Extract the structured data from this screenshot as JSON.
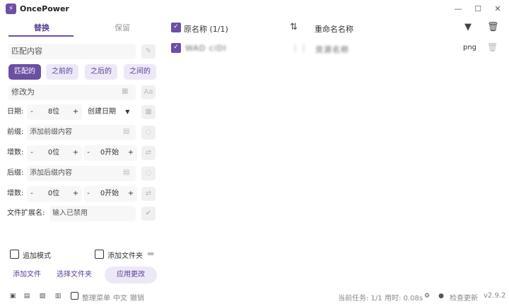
{
  "app": {
    "title": "OncePower",
    "logo_glyph": "⚡"
  },
  "window_controls": {
    "minimize": "—",
    "maximize": "☐",
    "close": "✕"
  },
  "tabs": [
    {
      "label": "替换"
    },
    {
      "label": "保留"
    }
  ],
  "replace": {
    "match_placeholder": "匹配内容",
    "modes": [
      "匹配的",
      "之前的",
      "之后的",
      "之间的"
    ],
    "active_mode": "匹配的",
    "modify_placeholder": "修改为"
  },
  "date": {
    "label": "日期:",
    "minus": "-",
    "plus": "+",
    "digits": "8位",
    "type": "创建日期"
  },
  "prefix": {
    "label": "前缀:",
    "placeholder": "添加前缀内容"
  },
  "prefix_increment": {
    "label": "增数:",
    "digits": "0位",
    "start": "0开始",
    "minus": "-",
    "plus": "+"
  },
  "suffix": {
    "label": "后缀:",
    "placeholder": "添加后缀内容"
  },
  "suffix_increment": {
    "label": "增数:",
    "digits": "0位",
    "start": "0开始",
    "minus": "-",
    "plus": "+"
  },
  "extension": {
    "label": "文件扩展名:",
    "placeholder": "输入已禁用"
  },
  "options": {
    "append_mode": "追加模式",
    "add_folder": "添加文件夹"
  },
  "actions": {
    "add_file": "添加文件",
    "select_folder": "选择文件夹",
    "apply": "应用更改"
  },
  "list": {
    "header_original": "原名称 (1/1)",
    "header_renamed": "重命名名称",
    "rows": [
      {
        "original": "WAD ciDI",
        "renamed": "资源名称",
        "ext": "png",
        "checked": true
      }
    ]
  },
  "footer": {
    "organize_menu": "整理菜单",
    "language": "中文",
    "undo": "撤销",
    "current_task": "当前任务: 1/1",
    "time_used": "用时: 0.08s",
    "check_update": "检查更新",
    "version": "v2.9.2"
  },
  "colors": {
    "accent": "#6b4fa2",
    "accent_light": "#ede8f6"
  }
}
